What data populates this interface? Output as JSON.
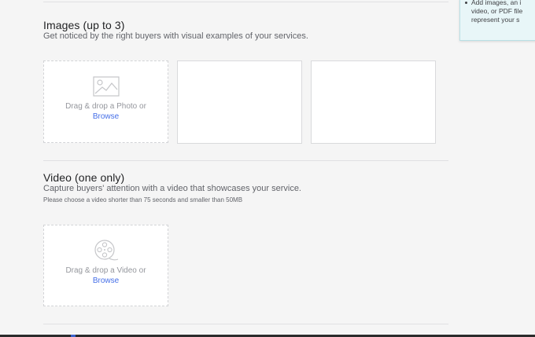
{
  "tip": {
    "line1": "Add images, an i",
    "line2": "video, or PDF file",
    "line3": "represent your s"
  },
  "images": {
    "title": "Images (up to 3)",
    "description": "Get noticed by the right buyers with visual examples of your services.",
    "dropzone": {
      "text": "Drag & drop a Photo or",
      "link": "Browse"
    }
  },
  "video": {
    "title": "Video (one only)",
    "description": "Capture buyers' attention with a video that showcases your service.",
    "note": "Please choose a video shorter than 75 seconds and smaller than 50MB",
    "dropzone": {
      "text": "Drag & drop a Video or",
      "link": "Browse"
    }
  },
  "colors": {
    "background": "#f5f5f5",
    "link": "#446ee7",
    "tip_background": "#e8f6f8"
  }
}
